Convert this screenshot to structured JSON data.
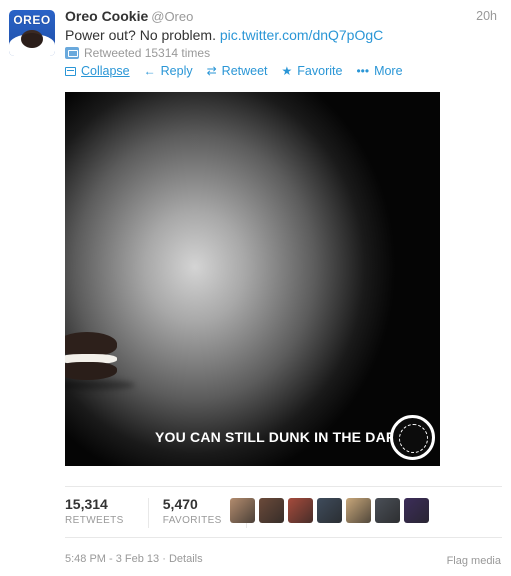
{
  "tweet": {
    "name": "Oreo Cookie",
    "handle": "@Oreo",
    "time": "20h",
    "text": "Power out? No problem.",
    "link": "pic.twitter.com/dnQ7pOgC",
    "retweeted": "Retweeted 15314 times"
  },
  "avatar": {
    "logo_text": "OREO"
  },
  "actions": {
    "collapse": "Collapse",
    "reply": "Reply",
    "retweet": "Retweet",
    "favorite": "Favorite",
    "more": "More"
  },
  "media": {
    "caption": "YOU CAN STILL DUNK IN THE DARK"
  },
  "stats": {
    "retweets": "15,314",
    "retweets_label": "RETWEETS",
    "favorites": "5,470",
    "favorites_label": "FAVORITES"
  },
  "favoriters": [
    {
      "color": "#b38c6e"
    },
    {
      "color": "#6b4a3a"
    },
    {
      "color": "#a64b3c"
    },
    {
      "color": "#3f4c5c"
    },
    {
      "color": "#c8a77a"
    },
    {
      "color": "#4a4f57"
    },
    {
      "color": "#3c2d5a"
    }
  ],
  "footer": {
    "timestamp": "5:48 PM - 3 Feb 13",
    "separator": " · ",
    "details": "Details",
    "flag": "Flag media"
  },
  "colors": {
    "link": "#2a96d6",
    "muted": "#999999",
    "text": "#333333"
  }
}
